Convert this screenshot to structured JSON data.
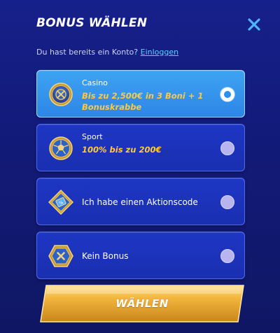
{
  "header": {
    "title": "BONUS WÄHLEN",
    "close_icon": "close-icon"
  },
  "login": {
    "prompt": "Du hast bereits ein Konto?",
    "link": "Einloggen"
  },
  "options": [
    {
      "label": "Casino",
      "bonus": "Bis zu 2,500€ in 3 Boni + 1 Bonuskrabbe",
      "icon": "casino-chip-icon",
      "selected": true
    },
    {
      "label": "Sport",
      "bonus": "100% bis zu 200€",
      "icon": "football-icon",
      "selected": false
    },
    {
      "label": "Ich habe einen Aktionscode",
      "icon": "promo-code-icon",
      "selected": false
    },
    {
      "label": "Kein Bonus",
      "icon": "no-bonus-icon",
      "selected": false
    }
  ],
  "cta": {
    "label": "WÄHLEN"
  },
  "colors": {
    "background": "#16208a",
    "card": "#1d36c4",
    "card_selected": "#3ea3f2",
    "bonus_text": "#ffc93a",
    "link": "#5fd0ff",
    "cta_gold": "#e0a326"
  }
}
